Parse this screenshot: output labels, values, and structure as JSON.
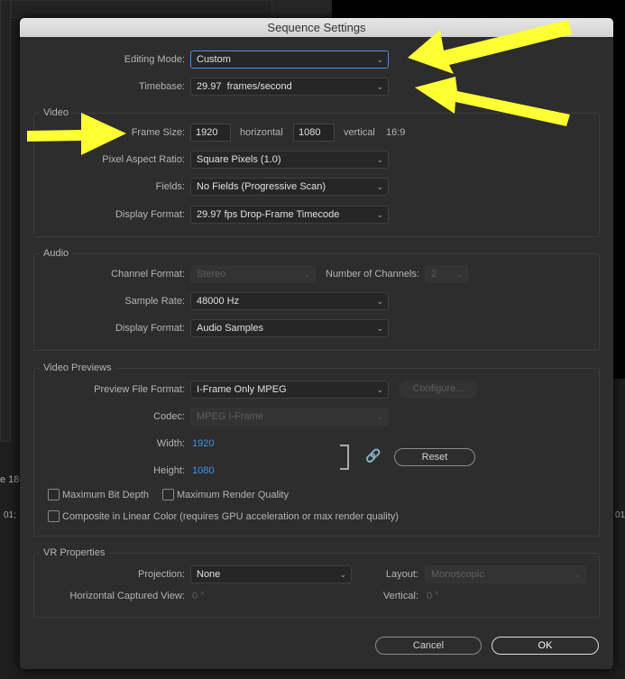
{
  "dialog": {
    "title": "Sequence Settings"
  },
  "general": {
    "editing_mode_label": "Editing Mode:",
    "editing_mode": "Custom",
    "timebase_label": "Timebase:",
    "timebase": "29.97  frames/second"
  },
  "video": {
    "title": "Video",
    "frame_size_label": "Frame Size:",
    "width": "1920",
    "horizontal": "horizontal",
    "height": "1080",
    "vertical": "vertical",
    "aspect": "16:9",
    "par_label": "Pixel Aspect Ratio:",
    "par": "Square Pixels (1.0)",
    "fields_label": "Fields:",
    "fields": "No Fields (Progressive Scan)",
    "display_label": "Display Format:",
    "display": "29.97 fps Drop-Frame Timecode"
  },
  "audio": {
    "title": "Audio",
    "channel_label": "Channel Format:",
    "channel": "Stereo",
    "num_channels_label": "Number of Channels:",
    "num_channels": "2",
    "sample_label": "Sample Rate:",
    "sample": "48000 Hz",
    "display_label": "Display Format:",
    "display": "Audio Samples"
  },
  "previews": {
    "title": "Video Previews",
    "format_label": "Preview File Format:",
    "format": "I-Frame Only MPEG",
    "configure": "Configure...",
    "codec_label": "Codec:",
    "codec": "MPEG I-Frame",
    "width_label": "Width:",
    "width": "1920",
    "height_label": "Height:",
    "height": "1080",
    "reset": "Reset",
    "max_bit_depth": "Maximum Bit Depth",
    "max_render": "Maximum Render Quality",
    "composite": "Composite in Linear Color (requires GPU acceleration or max render quality)"
  },
  "vr": {
    "title": "VR Properties",
    "projection_label": "Projection:",
    "projection": "None",
    "layout_label": "Layout:",
    "layout": "Monoscopic",
    "hview_label": "Horizontal Captured View:",
    "hview": "0 °",
    "vertical_label": "Vertical:",
    "vertical": "0 °"
  },
  "buttons": {
    "cancel": "Cancel",
    "ok": "OK"
  },
  "background": {
    "seq_label": "e 18",
    "tc_left": "01;",
    "tc_right": "01"
  },
  "colors": {
    "accent": "#3b94e6",
    "annotation": "#ffff33"
  }
}
